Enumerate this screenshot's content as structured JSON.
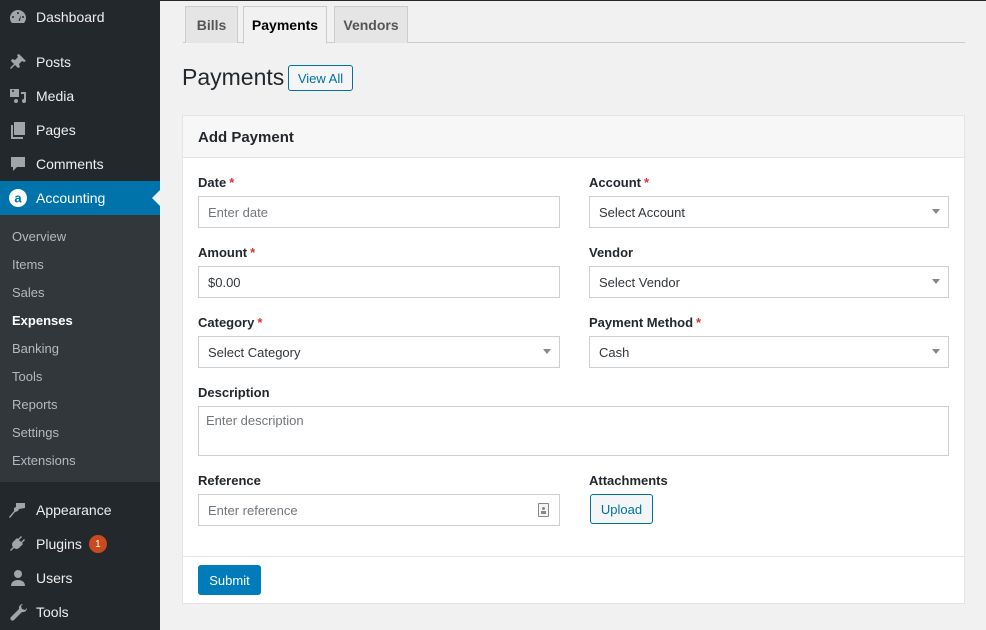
{
  "sidebar": {
    "items": [
      {
        "label": "Dashboard",
        "icon": "dashboard-icon"
      },
      {
        "label": "Posts",
        "icon": "pin-icon"
      },
      {
        "label": "Media",
        "icon": "media-icon"
      },
      {
        "label": "Pages",
        "icon": "pages-icon"
      },
      {
        "label": "Comments",
        "icon": "comment-icon"
      },
      {
        "label": "Accounting",
        "icon": "accounting-icon",
        "active": true
      },
      {
        "label": "Appearance",
        "icon": "paintbrush-icon"
      },
      {
        "label": "Plugins",
        "icon": "plugin-icon",
        "badge": "1"
      },
      {
        "label": "Users",
        "icon": "user-icon"
      },
      {
        "label": "Tools",
        "icon": "wrench-icon"
      }
    ],
    "submenu": [
      {
        "label": "Overview"
      },
      {
        "label": "Items"
      },
      {
        "label": "Sales"
      },
      {
        "label": "Expenses",
        "current": true
      },
      {
        "label": "Banking"
      },
      {
        "label": "Tools"
      },
      {
        "label": "Reports"
      },
      {
        "label": "Settings"
      },
      {
        "label": "Extensions"
      }
    ]
  },
  "tabs": [
    {
      "label": "Bills"
    },
    {
      "label": "Payments",
      "active": true
    },
    {
      "label": "Vendors"
    }
  ],
  "page": {
    "title": "Payments",
    "view_all_label": "View All"
  },
  "form": {
    "title": "Add Payment",
    "required_mark": "*",
    "date": {
      "label": "Date",
      "placeholder": "Enter date",
      "required": true
    },
    "account": {
      "label": "Account",
      "value": "Select Account",
      "required": true
    },
    "amount": {
      "label": "Amount",
      "value": "$0.00",
      "required": true
    },
    "vendor": {
      "label": "Vendor",
      "value": "Select Vendor"
    },
    "category": {
      "label": "Category",
      "value": "Select Category",
      "required": true
    },
    "payment_method": {
      "label": "Payment Method",
      "value": "Cash",
      "required": true
    },
    "description": {
      "label": "Description",
      "placeholder": "Enter description"
    },
    "reference": {
      "label": "Reference",
      "placeholder": "Enter reference"
    },
    "attachments": {
      "label": "Attachments",
      "upload_label": "Upload"
    },
    "submit_label": "Submit"
  },
  "colors": {
    "accent": "#0073aa",
    "button_primary": "#007cba",
    "required": "#dc3232",
    "badge": "#ca4a1f",
    "sidebar_bg": "#23282d",
    "submenu_bg": "#32373c"
  }
}
